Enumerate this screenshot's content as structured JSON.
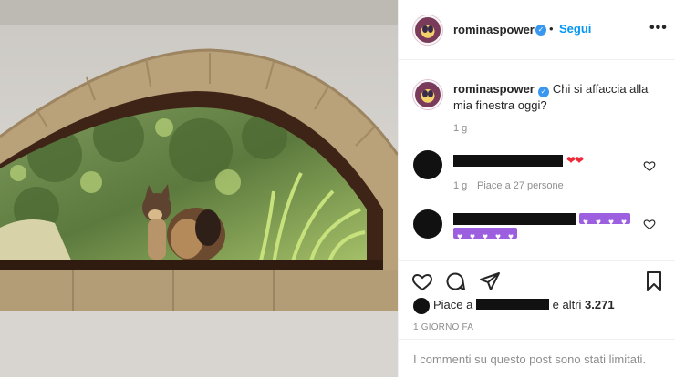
{
  "post": {
    "username": "rominaspower",
    "verified_mark": "✓",
    "dot": "•",
    "follow_label": "Segui",
    "more_icon": "more-icon",
    "more_glyph": "•••"
  },
  "caption": {
    "username": "rominaspower",
    "text": "Chi si affaccia alla mia finestra oggi?",
    "age": "1 g"
  },
  "comments": [
    {
      "emoji": "❤❤",
      "age": "1 g",
      "likes": "Piace a 27 persone"
    },
    {
      "emoji_row1": [
        "♥",
        "♥",
        "♥",
        "♥"
      ],
      "emoji_row2": [
        "♥",
        "♥",
        "♥",
        "♥",
        "♥"
      ]
    }
  ],
  "actions": {
    "like_icon": "heart-icon",
    "comment_icon": "comment-icon",
    "share_icon": "share-icon",
    "save_icon": "bookmark-icon"
  },
  "likes": {
    "prefix": "Piace a",
    "suffix": "e altri",
    "count": "3.271"
  },
  "timestamp": "1 GIORNO FA",
  "footer": {
    "text": "I commenti su questo post sono stati limitati."
  },
  "colors": {
    "accent": "#0095f6",
    "heart": "#ed2a39",
    "purple_emoji": "#9b5fe0"
  }
}
